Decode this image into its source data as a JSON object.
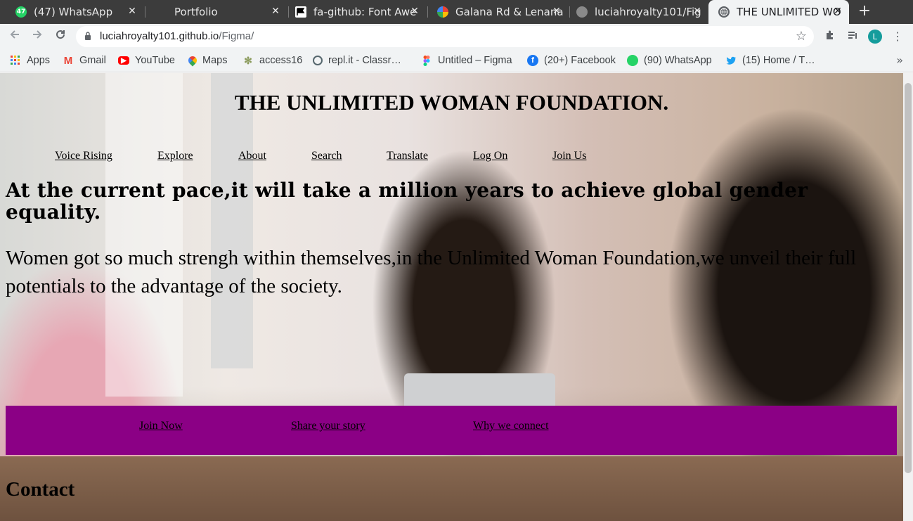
{
  "browser": {
    "tabs": [
      {
        "title": "(47) WhatsApp",
        "icon": "whatsapp-icon",
        "badge": "47",
        "color": "#25d366"
      },
      {
        "title": "Portfolio",
        "icon": "page-icon",
        "badge": "",
        "color": "#3c3c3c"
      },
      {
        "title": "fa-github: Font Awe",
        "icon": "flag-icon",
        "badge": "",
        "color": "#ffffff"
      },
      {
        "title": "Galana Rd & Lenana",
        "icon": "maps-icon",
        "badge": "",
        "color": "#ea4335"
      },
      {
        "title": "luciahroyalty101/Fig",
        "icon": "github-icon",
        "badge": "",
        "color": "#888888"
      },
      {
        "title": "THE UNLIMITED WO",
        "icon": "globe-icon",
        "badge": "",
        "color": "#5f6368"
      }
    ],
    "new_tab": "+",
    "url_host": "luciahroyalty101.github.io",
    "url_path": "/Figma/",
    "profile_initial": "L",
    "bookmarks": [
      {
        "label": "Apps",
        "icon": "apps-grid-icon",
        "color": "#4285f4"
      },
      {
        "label": "Gmail",
        "icon": "gmail-icon",
        "color": "#ea4335"
      },
      {
        "label": "YouTube",
        "icon": "youtube-icon",
        "color": "#ff0000"
      },
      {
        "label": "Maps",
        "icon": "maps-icon",
        "color": "#34a853"
      },
      {
        "label": "access16",
        "icon": "access-icon",
        "color": "#8a9a5b"
      },
      {
        "label": "repl.it - Classr…",
        "icon": "replit-icon",
        "color": "#56676e"
      },
      {
        "label": "Untitled – Figma",
        "icon": "figma-icon",
        "color": "#f24e1e"
      },
      {
        "label": "(20+) Facebook",
        "icon": "facebook-icon",
        "color": "#1877f2"
      },
      {
        "label": "(90) WhatsApp",
        "icon": "whatsapp-icon",
        "color": "#25d366"
      },
      {
        "label": "(15) Home / T…",
        "icon": "twitter-icon",
        "color": "#1da1f2"
      }
    ]
  },
  "page": {
    "title": "THE UNLIMITED WOMAN FOUNDATION.",
    "nav": [
      "Voice Rising",
      "Explore",
      "About",
      "Search",
      "Translate",
      "Log On",
      "Join Us"
    ],
    "headline": "At the current pace,it will take a million years to achieve global gender equality.",
    "lede": "Women got so much strengh within themselves,in the Unlimited Woman Foundation,we unveil their full potentials to the advantage of the society.",
    "band_links": [
      "Join Now",
      "Share your story",
      "Why we connect"
    ],
    "band_color": "#8b0085",
    "contact_heading": "Contact"
  }
}
